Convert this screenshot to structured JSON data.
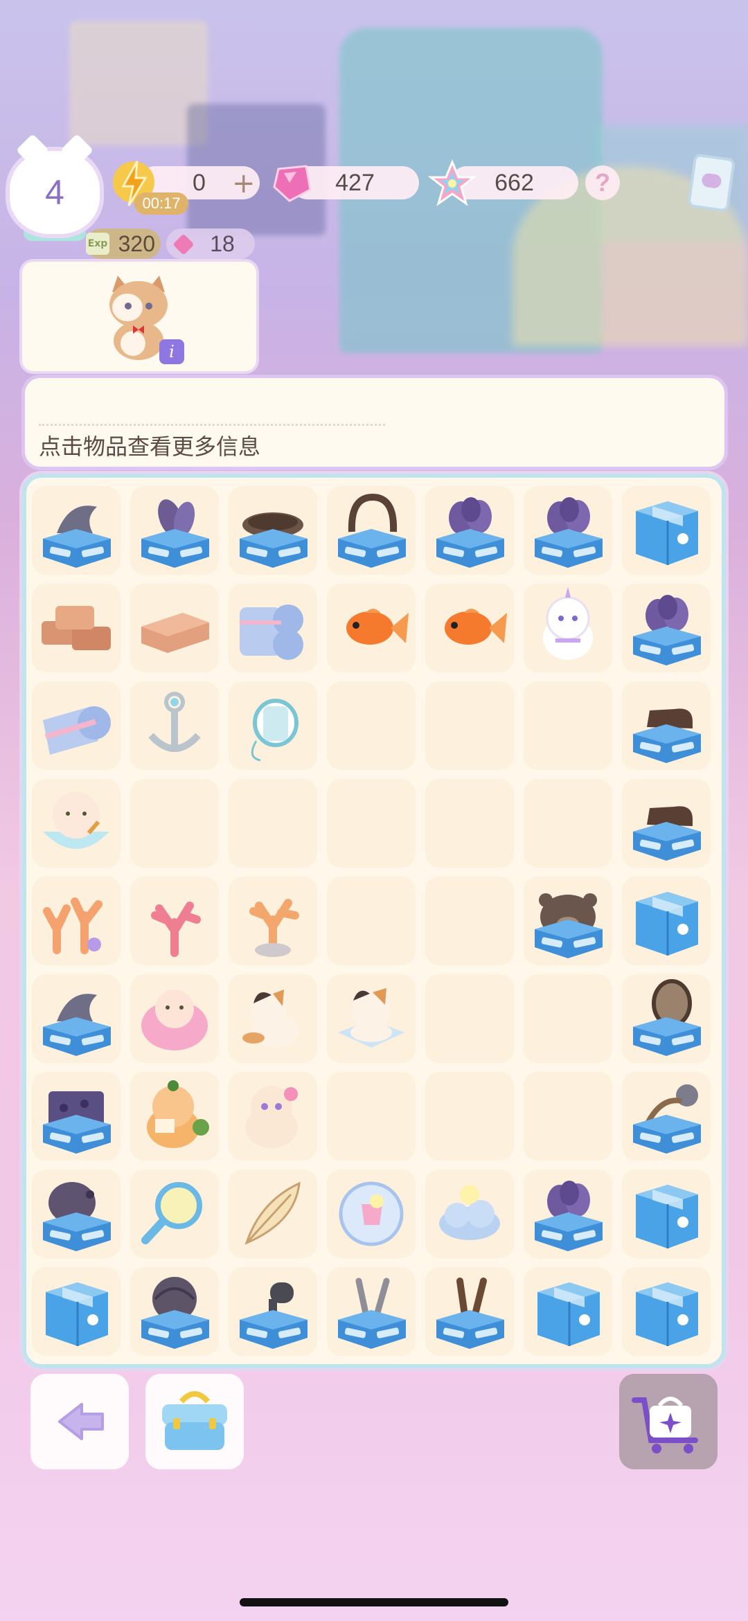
{
  "hud": {
    "level": "4",
    "energy": {
      "value": "0",
      "plus": "+",
      "timer": "00:17"
    },
    "gems": "427",
    "stars": "662",
    "help": "?",
    "exp": {
      "icon_text": "Exp",
      "value": "320"
    },
    "small_gems": "18"
  },
  "character": {
    "info_label": "i",
    "icon": "calico-cat-icon"
  },
  "info_panel": {
    "hint": "点击物品查看更多信息"
  },
  "board": {
    "cols": 7,
    "rows": 9,
    "cells": [
      [
        "shell-box",
        "mussel-box",
        "tray-box",
        "basket-box",
        "flower-box",
        "flower-box",
        "gift-box"
      ],
      [
        "bricks",
        "brick",
        "towel-rolls",
        "goldfish",
        "goldfish",
        "unicorn-cat",
        "flower-box"
      ],
      [
        "towel-roll",
        "anchor",
        "thread-spool",
        "",
        "",
        "",
        "boot-box"
      ],
      [
        "hamster-bowl",
        "",
        "",
        "",
        "",
        "",
        "boot-box"
      ],
      [
        "coral-cluster",
        "coral-pink",
        "coral-orange",
        "",
        "",
        "bear-box",
        "gift-box"
      ],
      [
        "shell-box",
        "pink-hamster",
        "calico-kitten",
        "calico-cat-bed",
        "",
        "",
        "racket-box"
      ],
      [
        "circuit-box",
        "orange-cat",
        "cream-cat",
        "",
        "",
        "",
        "scissors-box"
      ],
      [
        "dish-box",
        "magnifier",
        "feather",
        "bubble",
        "cloud",
        "flower-box",
        "gift-box"
      ],
      [
        "gift-box",
        "yarn-box",
        "hammer-box",
        "tweezers-box",
        "tongs-box",
        "gift-box",
        "gift-box"
      ]
    ]
  },
  "bottom_bar": {
    "back": "back-arrow-icon",
    "chest": "toolbox-icon",
    "shop": "shopping-cart-icon"
  },
  "colors": {
    "board_bg": "#fff8ea",
    "cell_bg": "#fdf1dd",
    "box_blue": "#3e90d6",
    "accent_purple": "#8b6fc4"
  }
}
